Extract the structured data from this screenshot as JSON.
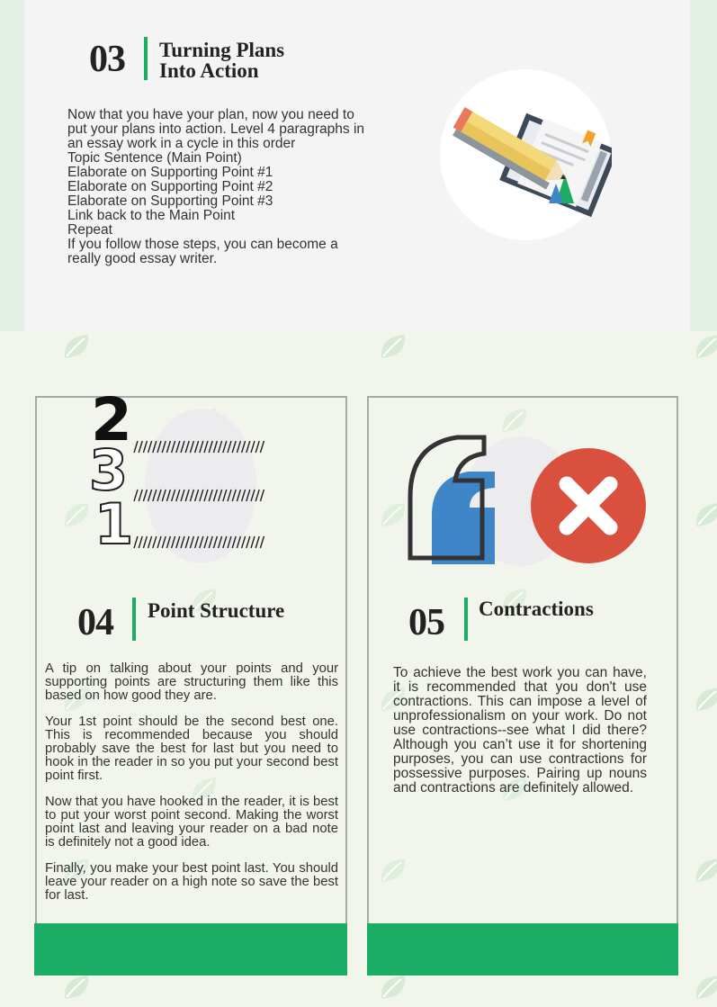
{
  "section03": {
    "number": "03",
    "title_line1": "Turning Plans",
    "title_line2": "Into Action",
    "lines": [
      "Now that you have your plan, now you need to",
      "put your plans into action.  Level 4 paragraphs in",
      "an essay work in a cycle in this order",
      "Topic Sentence (Main Point)",
      "Elaborate on Supporting Point #1",
      "Elaborate on Supporting Point #2",
      "Elaborate on Supporting Point #3",
      "Link back to the Main Point",
      "Repeat",
      "If you follow those steps, you can become  a",
      "really good essay writer."
    ]
  },
  "section04": {
    "ranking_numbers": [
      "2",
      "3",
      "1"
    ],
    "number": "04",
    "title": "Point Structure",
    "paragraphs": [
      "A tip on talking about your points and your supporting points are structuring them like this based on how good they are.",
      "Your 1st point should be the second best one. This is recommended because you should probably save the best for last but you need to hook in the reader in so you put your second best point first.",
      "Now that you have hooked in the reader, it is best to put your worst point second. Making the worst point last and leaving your reader on a bad note is definitely not a good idea.",
      "Finally, you make your best point last. You should leave your reader on a high note so save the best for last."
    ]
  },
  "section05": {
    "number": "05",
    "title": "Contractions",
    "paragraph": "To achieve the best work you can have, it is recommended that you don't use contractions. This can impose a level of unprofessionalism on your work. Do not use contractions--see what I did there? Although you can’t use it for shortening purposes, you can use contractions for possessive purposes. Pairing up nouns and contractions are definitely allowed."
  },
  "colors": {
    "accent_green": "#1aad63",
    "leaf_green": "#d6ead6",
    "x_red": "#d9503f",
    "quote_blue": "#3f86c8"
  },
  "icons": [
    "leaf-icon",
    "pencil-notebook-icon",
    "apostrophe-icon",
    "x-mark-icon"
  ]
}
